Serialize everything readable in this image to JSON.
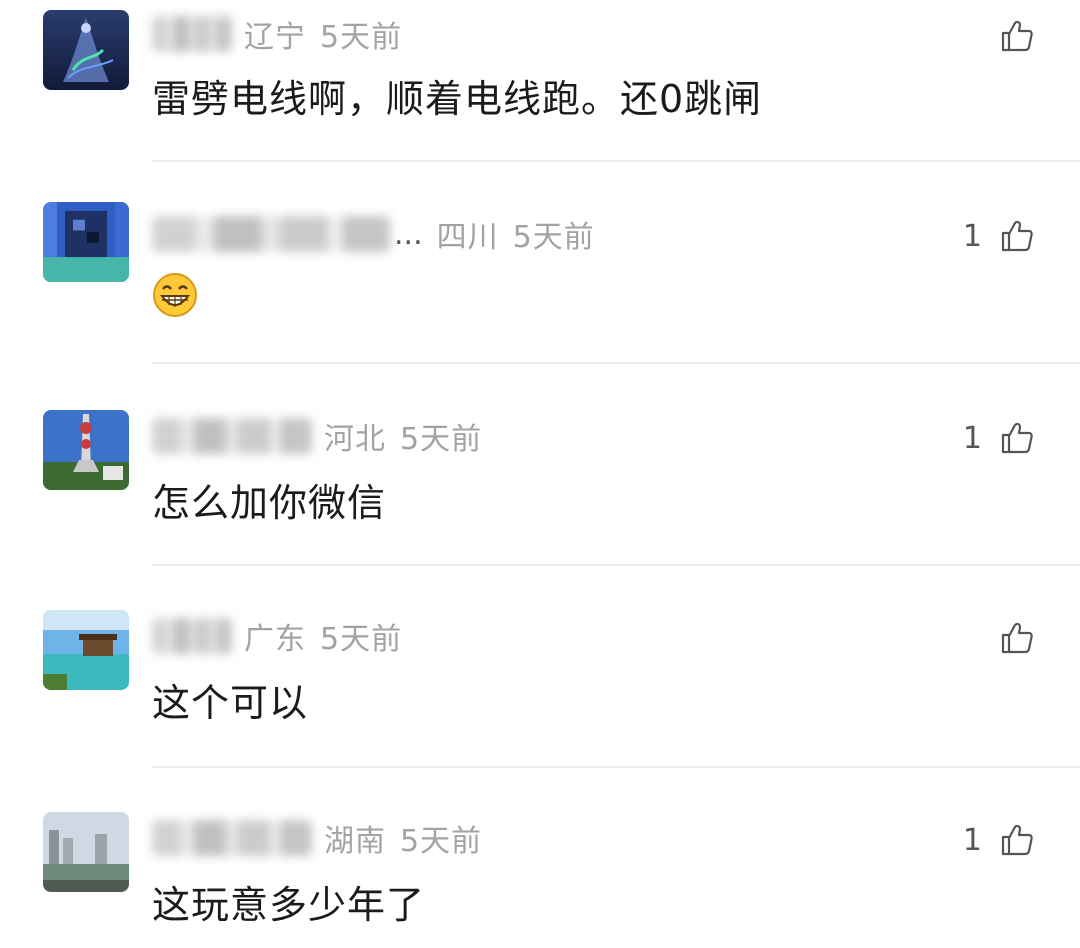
{
  "comments": [
    {
      "location": "辽宁",
      "time": "5天前",
      "text": "雷劈电线啊，顺着电线跑。还0跳闸",
      "likes": ""
    },
    {
      "name_suffix": "...",
      "location": "四川",
      "time": "5天前",
      "text": "",
      "emoji": "grinning-face-emoji",
      "likes": "1"
    },
    {
      "location": "河北",
      "time": "5天前",
      "text": "怎么加你微信",
      "likes": "1"
    },
    {
      "location": "广东",
      "time": "5天前",
      "text": "这个可以",
      "likes": ""
    },
    {
      "location": "湖南",
      "time": "5天前",
      "text": "这玩意多少年了",
      "likes": "1"
    }
  ],
  "icons": {
    "like": "thumbs-up-icon"
  },
  "colors": {
    "text": "#1b1b1b",
    "meta": "#a3a3a3",
    "divider": "#ececec"
  }
}
